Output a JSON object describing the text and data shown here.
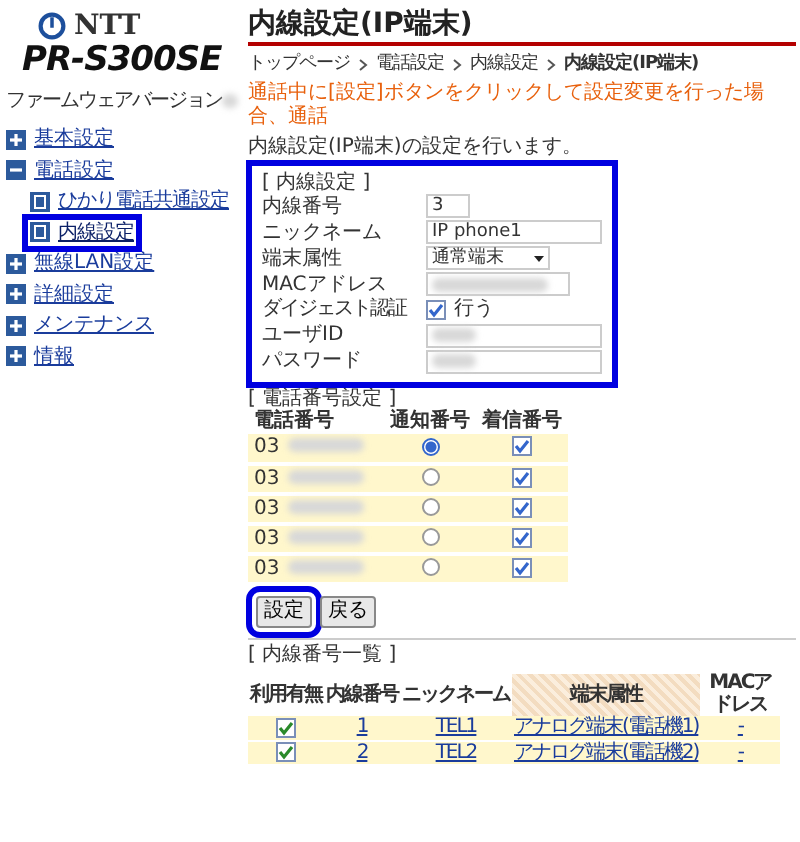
{
  "logo": {
    "brand": "NTT",
    "model": "PR-S300SE"
  },
  "firmware": {
    "label": "ファームウェアバージョン",
    "blurred": true
  },
  "sidebar": {
    "items": [
      {
        "label": "基本設定",
        "expanded": false
      },
      {
        "label": "電話設定",
        "expanded": true,
        "children": [
          {
            "label": "ひかり電話共通設定",
            "selected": false,
            "highlighted": false
          },
          {
            "label": "内線設定",
            "selected": true,
            "highlighted": true
          }
        ]
      },
      {
        "label": "無線LAN設定",
        "expanded": false
      },
      {
        "label": "詳細設定",
        "expanded": false
      },
      {
        "label": "メンテナンス",
        "expanded": false
      },
      {
        "label": "情報",
        "expanded": false
      }
    ]
  },
  "page_title": "内線設定(IP端末)",
  "breadcrumb": [
    {
      "label": "トップページ",
      "current": false
    },
    {
      "label": "電話設定",
      "current": false
    },
    {
      "label": "内線設定",
      "current": false
    },
    {
      "label": "内線設定(IP端末)",
      "current": true
    }
  ],
  "warning": "通話中に[設定]ボタンをクリックして設定変更を行った場合、通話",
  "description": "内線設定(IP端末)の設定を行います。",
  "extension_settings": {
    "heading": "[ 内線設定 ]",
    "highlighted": true,
    "fields": [
      {
        "kind": "text",
        "label": "内線番号",
        "value": "3"
      },
      {
        "kind": "text",
        "label": "ニックネーム",
        "value": "IP phone1"
      },
      {
        "kind": "select",
        "label": "端末属性",
        "value": "通常端末"
      },
      {
        "kind": "text",
        "label": "MACアドレス",
        "blurred": true
      },
      {
        "kind": "checkbox",
        "label": "ダイジェスト認証",
        "checked": true,
        "text": "行う"
      },
      {
        "kind": "text",
        "label": "ユーザID",
        "blurred": true
      },
      {
        "kind": "text",
        "label": "パスワード",
        "blurred": true
      }
    ]
  },
  "phone_numbers": {
    "heading": "[ 電話番号設定 ]",
    "columns": [
      "電話番号",
      "通知番号",
      "着信番号"
    ],
    "rows": [
      {
        "number": "03",
        "blurred": true,
        "notify_selected": true,
        "incoming_checked": true
      },
      {
        "number": "03",
        "blurred": true,
        "notify_selected": false,
        "incoming_checked": true
      },
      {
        "number": "03",
        "blurred": true,
        "notify_selected": false,
        "incoming_checked": true
      },
      {
        "number": "03",
        "blurred": true,
        "notify_selected": false,
        "incoming_checked": true
      },
      {
        "number": "03",
        "blurred": true,
        "notify_selected": false,
        "incoming_checked": true
      }
    ]
  },
  "buttons": [
    {
      "label": "設定",
      "highlighted": true
    },
    {
      "label": "戻る",
      "highlighted": false
    }
  ],
  "extension_list": {
    "heading": "[ 内線番号一覧 ]",
    "columns": [
      {
        "label": "利用有無",
        "sorted": false
      },
      {
        "label": "内線番号",
        "sorted": false
      },
      {
        "label": "ニックネーム",
        "sorted": false
      },
      {
        "label": "端末属性",
        "sorted": true
      },
      {
        "label": "MACアドレス",
        "sorted": false
      }
    ],
    "rows": [
      {
        "enabled": true,
        "number": "1",
        "nickname": "TEL1",
        "type": "アナログ端末(電話機1)",
        "mac": "-"
      },
      {
        "enabled": true,
        "number": "2",
        "nickname": "TEL2",
        "type": "アナログ端末(電話機2)",
        "mac": "-"
      }
    ]
  }
}
